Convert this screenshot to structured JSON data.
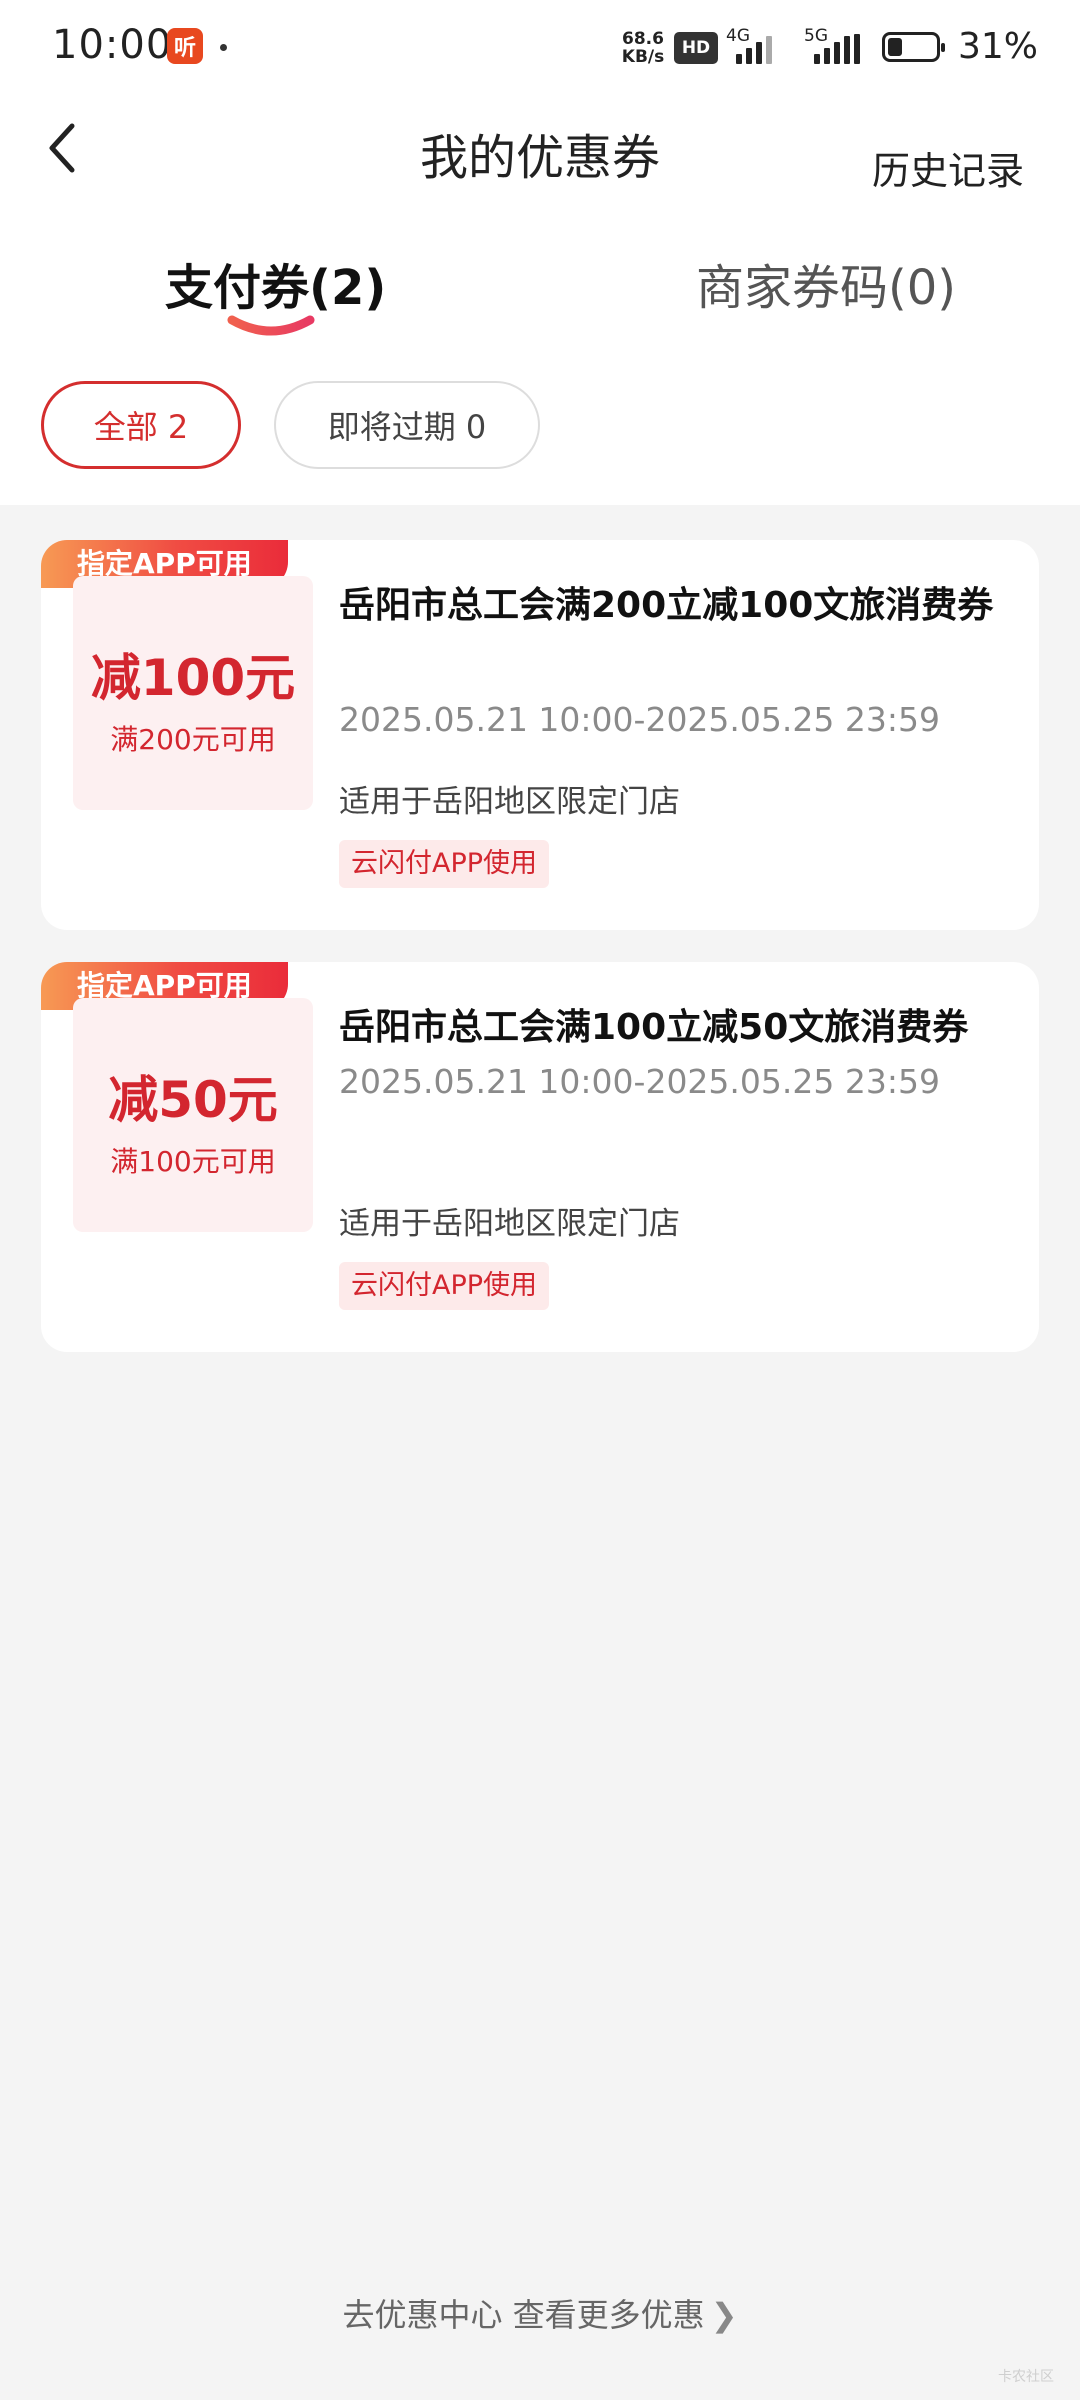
{
  "status_bar": {
    "time": "10:00",
    "app_icon_glyph": "听",
    "net_speed_value": "68.6",
    "net_speed_unit": "KB/s",
    "hd_label": "HD",
    "sig1_label": "4G",
    "sig2_label": "5G",
    "battery_percent": "31%",
    "battery_level": 0.31
  },
  "nav": {
    "title": "我的优惠券",
    "history_label": "历史记录",
    "back_icon": "chevron-left-icon"
  },
  "tabs": {
    "pay": "支付券(2)",
    "merchant": "商家券码(0)",
    "accent_color": "#e8344a"
  },
  "filters": {
    "all": "全部 2",
    "expiring": "即将过期 0"
  },
  "coupons": [
    {
      "tag": "指定APP可用",
      "amount": "减100元",
      "condition": "满200元可用",
      "title": "岳阳市总工会满200立减100文旅消费券",
      "time": "2025.05.21 10:00-2025.05.25 23:59",
      "scope": "适用于岳阳地区限定门店",
      "badge": "云闪付APP使用"
    },
    {
      "tag": "指定APP可用",
      "amount": "减50元",
      "condition": "满100元可用",
      "title": "岳阳市总工会满100立减50文旅消费券",
      "time": "2025.05.21 10:00-2025.05.25 23:59",
      "scope": "适用于岳阳地区限定门店",
      "badge": "云闪付APP使用"
    }
  ],
  "footer": {
    "link": "去优惠中心 查看更多优惠",
    "watermark": "卡农社区"
  },
  "colors": {
    "brand_red": "#d3262f",
    "background": "#f4f4f4"
  }
}
